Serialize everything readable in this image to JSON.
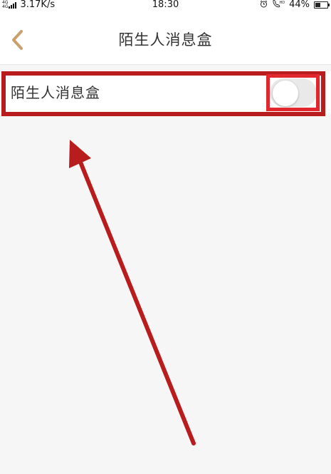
{
  "status_bar": {
    "network_type_top": "4G",
    "network_type_bottom": "4G",
    "net_speed": "3.17K/s",
    "time": "18:30",
    "alarm_icon": "alarm-clock-icon",
    "hd_call_icon": "hd-call-icon",
    "battery_percent": "44%",
    "battery_level": 0.44
  },
  "nav": {
    "back_icon": "chevron-left-icon",
    "title": "陌生人消息盒"
  },
  "settings": {
    "stranger_box": {
      "label": "陌生人消息盒",
      "toggle_on": false
    }
  },
  "colors": {
    "accent": "#c9a06a",
    "annotation": "#b81c1c",
    "annotation_bright": "#e1272d",
    "background": "#f6f6f6"
  }
}
